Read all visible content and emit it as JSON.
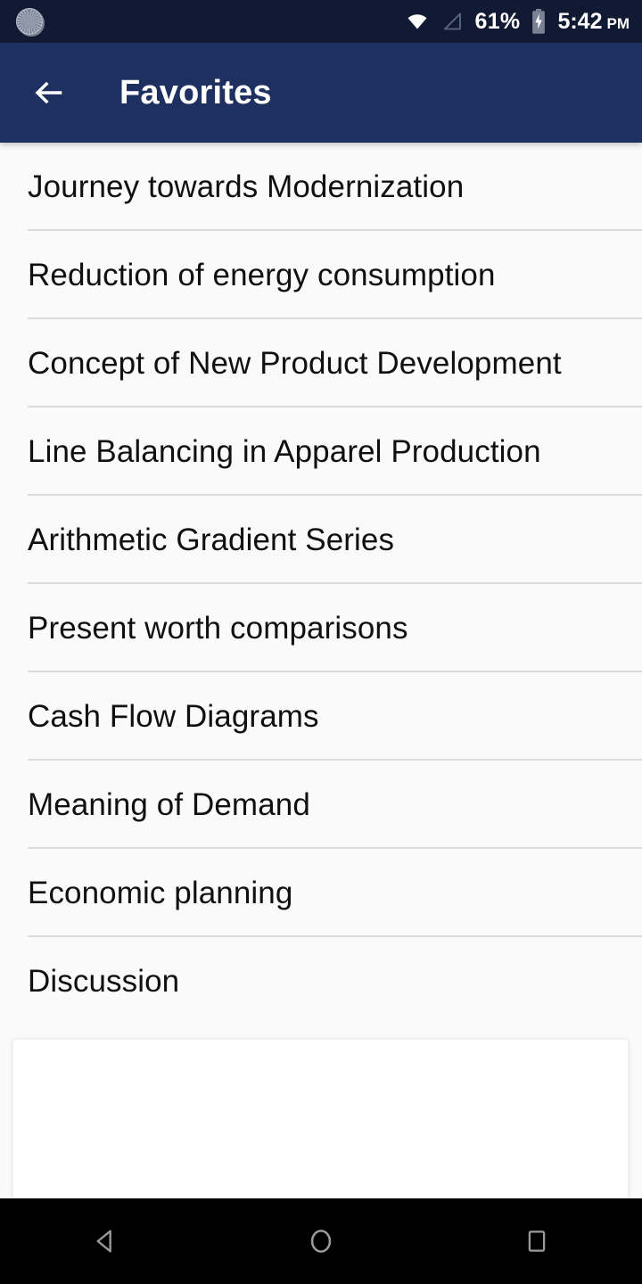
{
  "status_bar": {
    "notification_icon": "sync-spinner-icon",
    "wifi_icon": "wifi-icon",
    "signal_icon": "cellular-signal-no-bars-icon",
    "battery_percent": "61%",
    "battery_icon": "battery-charging-icon",
    "time": "5:42",
    "ampm": "PM",
    "background_color": "#101b33",
    "text_color": "#ffffff"
  },
  "app_bar": {
    "back_icon": "arrow-left-icon",
    "title": "Favorites",
    "background_color": "#1e3060",
    "text_color": "#ffffff"
  },
  "list": {
    "background_color": "#fafafa",
    "divider_color": "#dcdcdc",
    "items": [
      {
        "label": "Journey towards Modernization"
      },
      {
        "label": "Reduction of energy consumption"
      },
      {
        "label": "Concept of New Product Development"
      },
      {
        "label": "Line Balancing in Apparel Production"
      },
      {
        "label": "Arithmetic Gradient Series"
      },
      {
        "label": "Present worth comparisons"
      },
      {
        "label": "Cash Flow Diagrams"
      },
      {
        "label": "Meaning of Demand"
      },
      {
        "label": "Economic planning"
      },
      {
        "label": "Discussion"
      }
    ]
  },
  "content_card": {
    "background_color": "#ffffff",
    "content": ""
  },
  "nav_bar": {
    "background_color": "#000000",
    "buttons": [
      {
        "name": "back",
        "icon": "triangle-back-icon"
      },
      {
        "name": "home",
        "icon": "circle-home-icon"
      },
      {
        "name": "recents",
        "icon": "square-recents-icon"
      }
    ]
  }
}
